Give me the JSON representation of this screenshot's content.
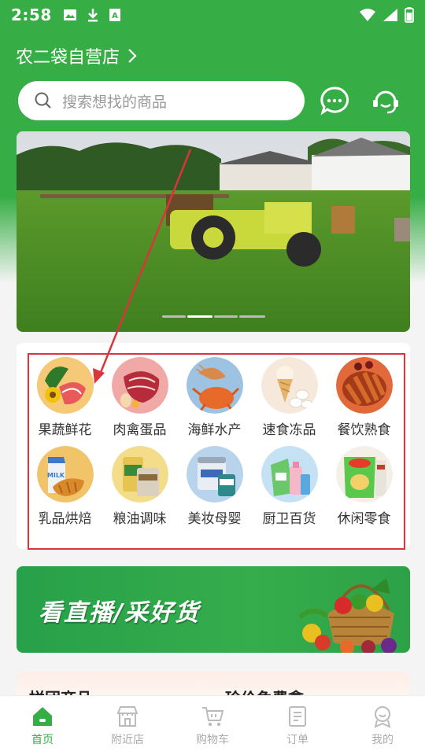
{
  "status_bar": {
    "time": "2:58"
  },
  "header": {
    "store_name": "农二袋自营店",
    "search_placeholder": "搜索想找的商品"
  },
  "categories": [
    {
      "label": "果蔬鲜花",
      "icon": "vegetables-icon"
    },
    {
      "label": "肉禽蛋品",
      "icon": "meat-icon"
    },
    {
      "label": "海鲜水产",
      "icon": "seafood-icon"
    },
    {
      "label": "速食冻品",
      "icon": "frozen-food-icon"
    },
    {
      "label": "餐饮熟食",
      "icon": "cooked-food-icon"
    },
    {
      "label": "乳品烘焙",
      "icon": "dairy-bakery-icon"
    },
    {
      "label": "粮油调味",
      "icon": "grain-oil-icon"
    },
    {
      "label": "美妆母婴",
      "icon": "beauty-baby-icon"
    },
    {
      "label": "厨卫百货",
      "icon": "kitchen-bath-icon"
    },
    {
      "label": "休闲零食",
      "icon": "snacks-icon"
    }
  ],
  "live_banner": {
    "text": "看直播/采好货"
  },
  "group_section": {
    "left_title": "拼团商品",
    "right_title": "珍价免费拿"
  },
  "tabbar": {
    "items": [
      {
        "label": "首页",
        "icon": "home-icon",
        "active": true
      },
      {
        "label": "附近店",
        "icon": "store-icon",
        "active": false
      },
      {
        "label": "购物车",
        "icon": "cart-icon",
        "active": false
      },
      {
        "label": "订单",
        "icon": "order-icon",
        "active": false
      },
      {
        "label": "我的",
        "icon": "profile-icon",
        "active": false
      }
    ]
  },
  "colors": {
    "brand_green": "#36ad45",
    "highlight_red": "#d9353a"
  }
}
